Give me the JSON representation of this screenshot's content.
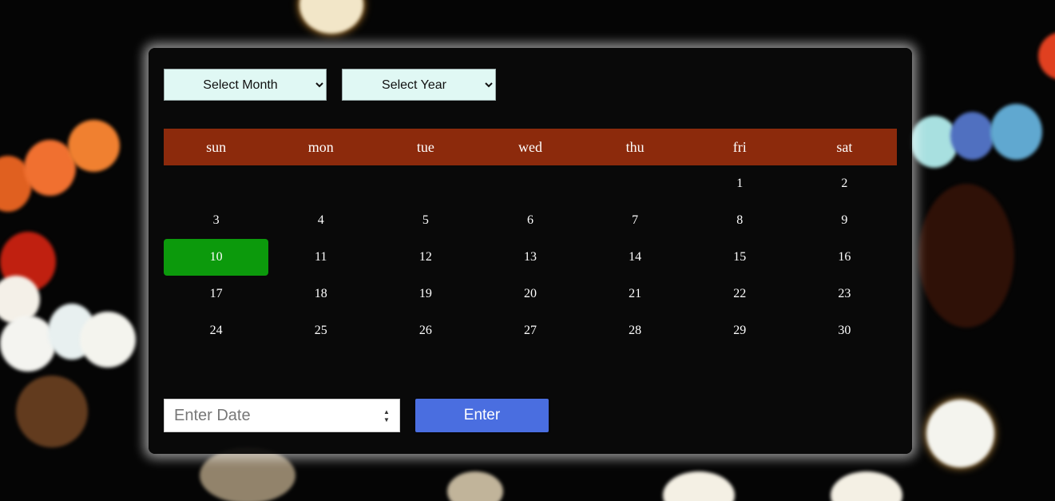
{
  "selects": {
    "month_label": "Select Month",
    "year_label": "Select Year"
  },
  "weekdays": [
    "sun",
    "mon",
    "tue",
    "wed",
    "thu",
    "fri",
    "sat"
  ],
  "days": {
    "leading_blanks": 5,
    "numbers": [
      "1",
      "2",
      "3",
      "4",
      "5",
      "6",
      "7",
      "8",
      "9",
      "10",
      "11",
      "12",
      "13",
      "14",
      "15",
      "16",
      "17",
      "18",
      "19",
      "20",
      "21",
      "22",
      "23",
      "24",
      "25",
      "26",
      "27",
      "28",
      "29",
      "30"
    ],
    "selected": "10"
  },
  "bottom": {
    "date_placeholder": "Enter Date",
    "enter_label": "Enter"
  },
  "colors": {
    "header": "#8c2a0c",
    "selected_day": "#0c9a0c",
    "enter_button": "#4a6ee0",
    "select_bg": "#e0f8f4"
  }
}
